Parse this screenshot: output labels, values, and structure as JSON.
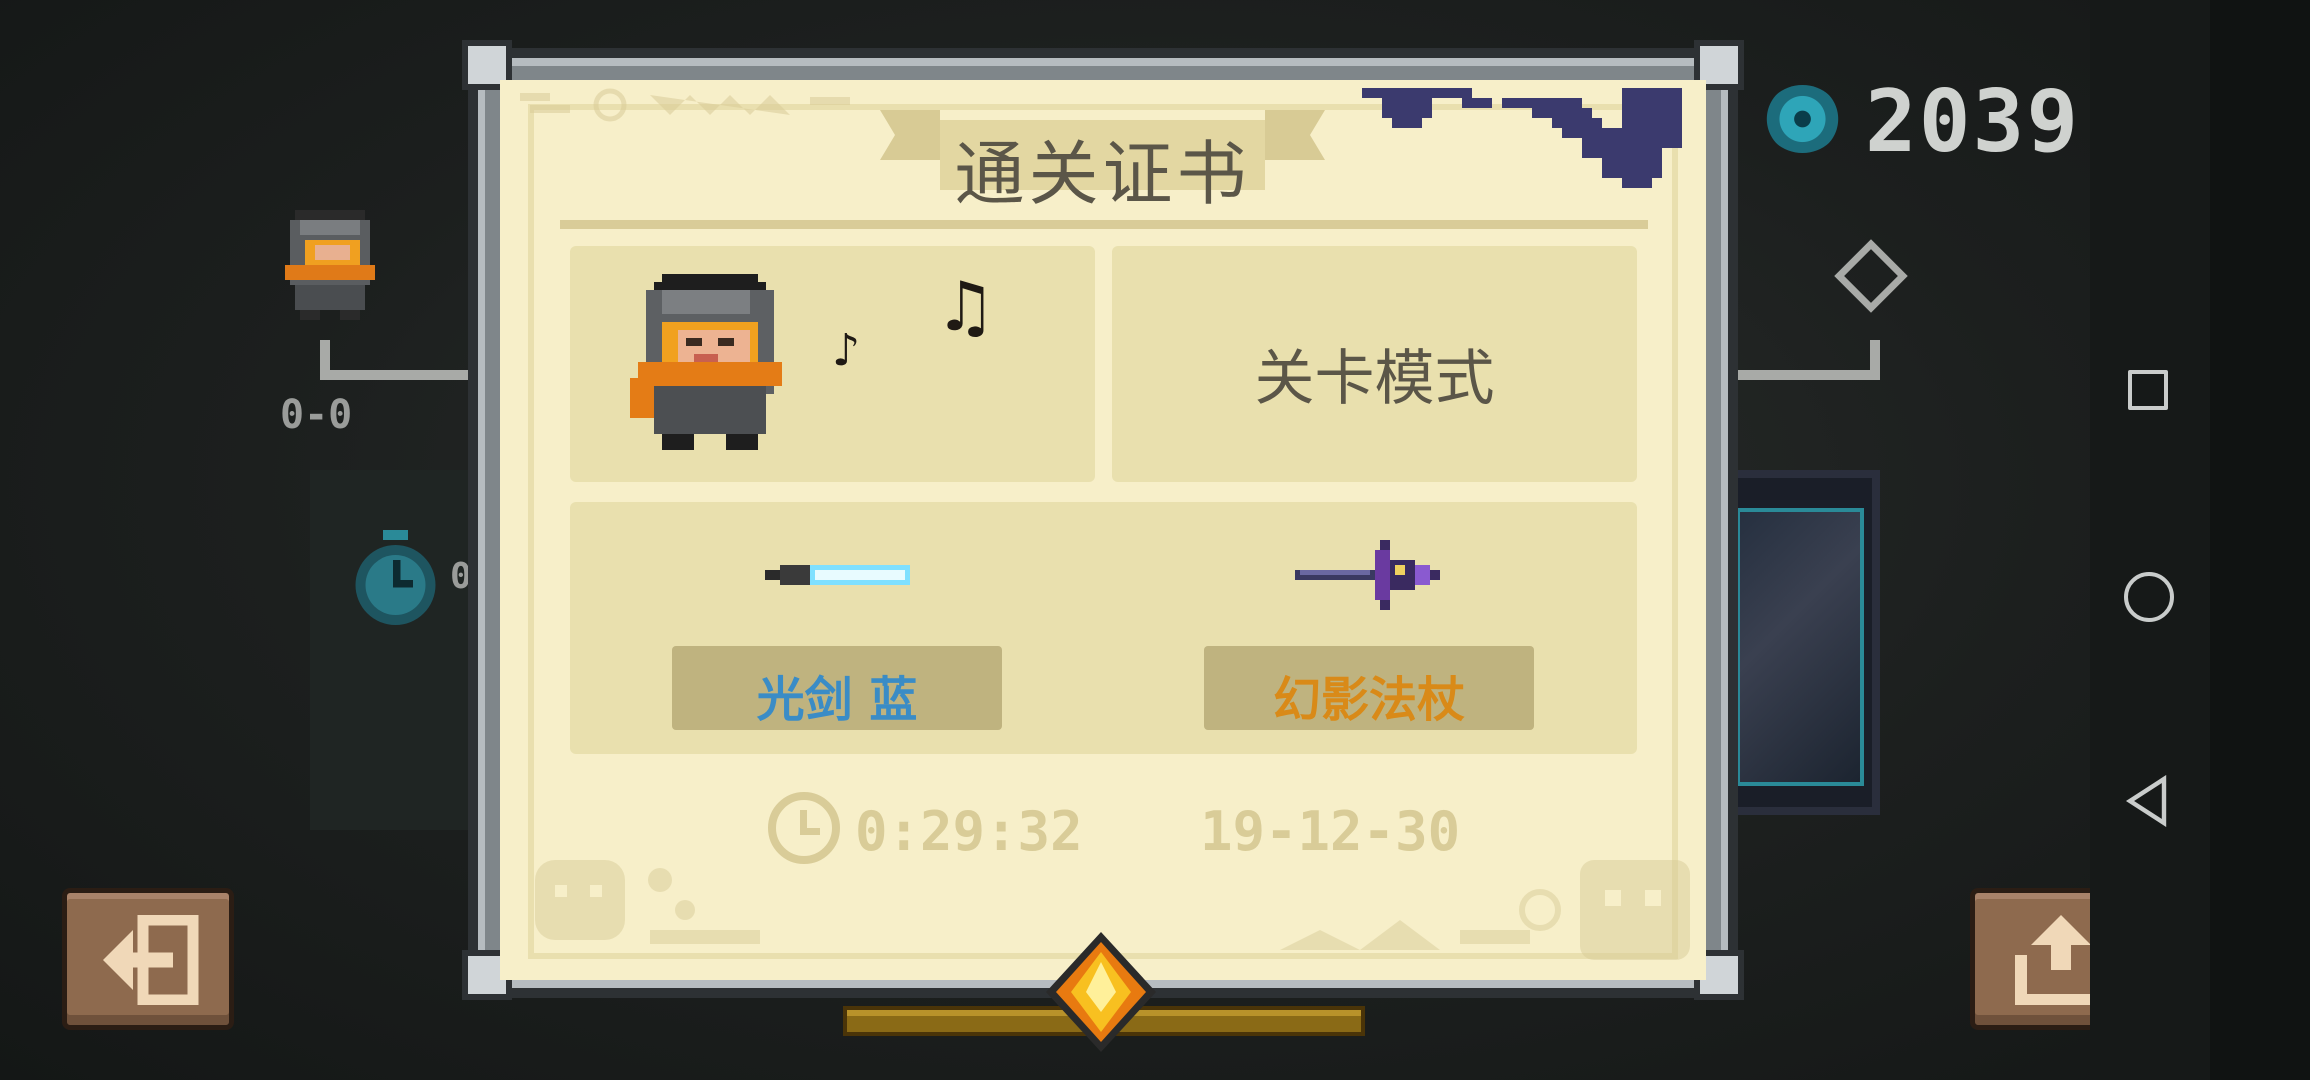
{
  "certificate": {
    "title": "通关证书",
    "mode": "关卡模式",
    "weapon_left": "光剑 蓝",
    "weapon_right": "幻影法杖",
    "time": "0:29:32",
    "date": "19-12-30"
  },
  "hud": {
    "gem_count": "2039",
    "score": "0-0",
    "side_value": "0"
  },
  "icons": {
    "gem": "blue-gem-icon",
    "diamond": "diamond-outline-icon",
    "stopwatch": "stopwatch-icon",
    "exit": "exit-icon",
    "share": "share-icon",
    "clock": "clock-icon",
    "music": "music-note-icon"
  },
  "colors": {
    "paper": "#f7efc9",
    "panel": "#e9e0ae",
    "weapon_left": "#3a8cc6",
    "weapon_right": "#d98a18",
    "button": "#8e6a4e"
  }
}
